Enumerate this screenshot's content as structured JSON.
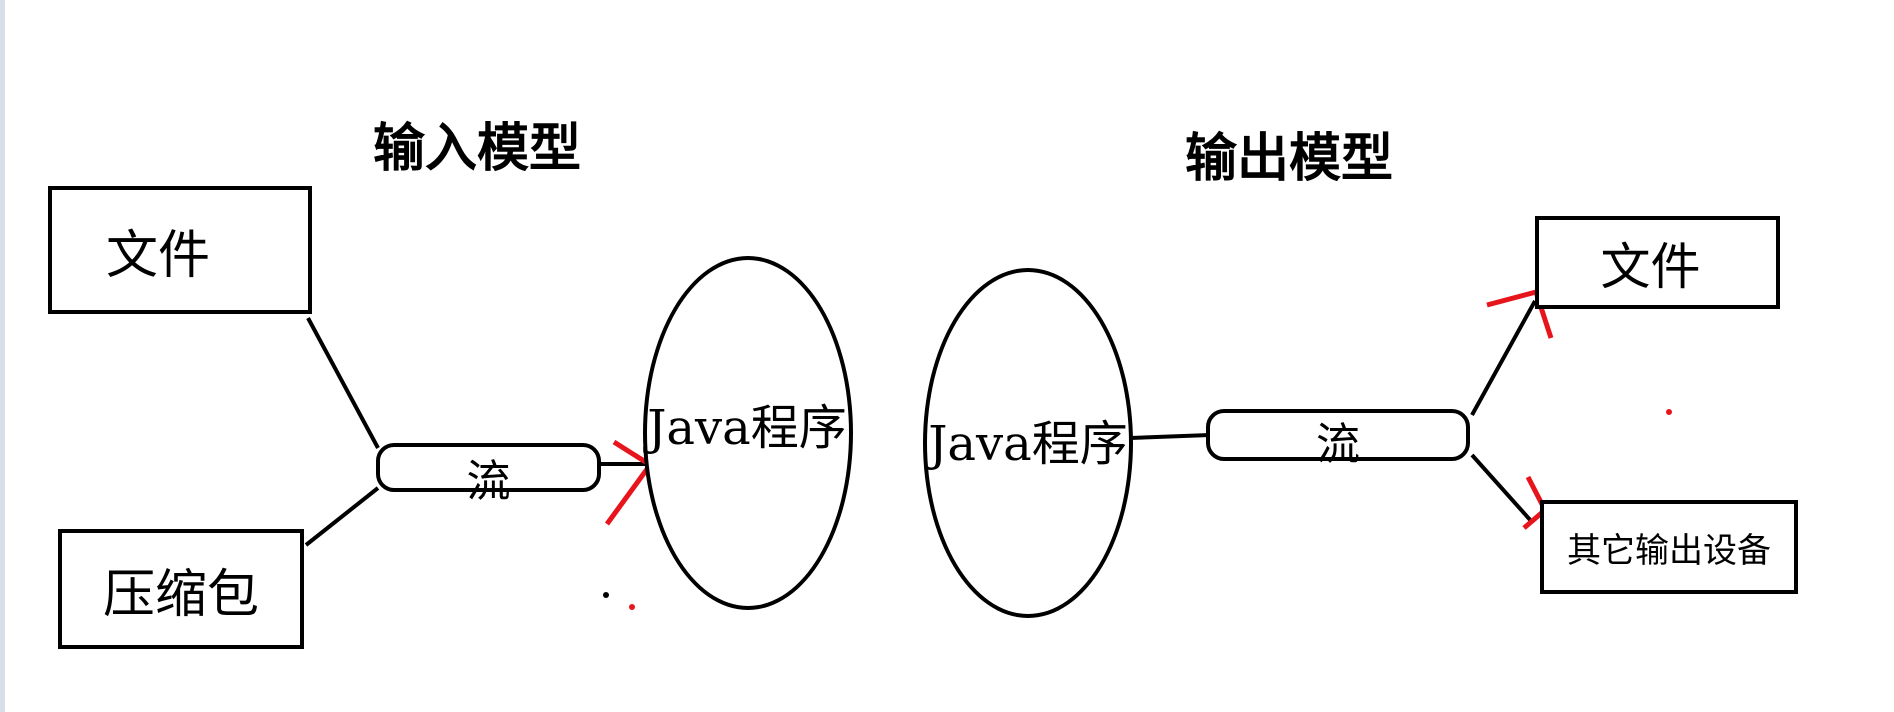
{
  "input_model": {
    "title": "输入模型",
    "sources": [
      {
        "label": "文件"
      },
      {
        "label": "压缩包"
      }
    ],
    "stream_label": "流",
    "program_label": "Java程序"
  },
  "output_model": {
    "title": "输出模型",
    "program_label": "Java程序",
    "stream_label": "流",
    "targets": [
      {
        "label": "文件"
      },
      {
        "label": "其它输出设备"
      }
    ]
  },
  "colors": {
    "stroke": "#000000",
    "arrow": "#e8141c"
  }
}
